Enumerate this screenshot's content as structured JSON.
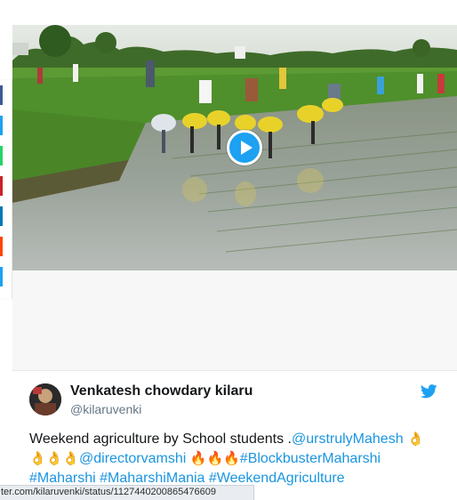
{
  "share_rail": {
    "buttons": [
      {
        "name": "share-facebook",
        "color": "#3b5998"
      },
      {
        "name": "share-twitter",
        "color": "#1da1f2"
      },
      {
        "name": "share-whatsapp",
        "color": "#25d366"
      },
      {
        "name": "share-pinterest",
        "color": "#cb2027"
      },
      {
        "name": "share-linkedin",
        "color": "#0077b5"
      },
      {
        "name": "share-reddit",
        "color": "#ff4500"
      },
      {
        "name": "share-more",
        "color": "#1da1f2"
      }
    ]
  },
  "video": {
    "description_icon": "play-icon",
    "accent": "#1da1f2"
  },
  "tweet": {
    "display_name": "Venkatesh chowdary kilaru",
    "handle": "@kilaruvenki",
    "text_plain_1": "Weekend agriculture by School students .",
    "mention_1": "@urstrulyMahesh",
    "emoji_ok_1": "👌",
    "emoji_ok_row": "👌👌👌",
    "mention_2": "@directorvamshi",
    "emoji_fire": "🔥🔥🔥",
    "hashtag_1": "#BlockbusterMaharshi",
    "hashtag_2": "#Maharshi",
    "hashtag_3": "#MaharshiMania",
    "hashtag_4": "#WeekendAgriculture",
    "brand_icon": "twitter-bird-icon",
    "link_color": "#1b95e0"
  },
  "status_bar": {
    "url": "ter.com/kilaruvenki/status/1127440200865476609"
  }
}
